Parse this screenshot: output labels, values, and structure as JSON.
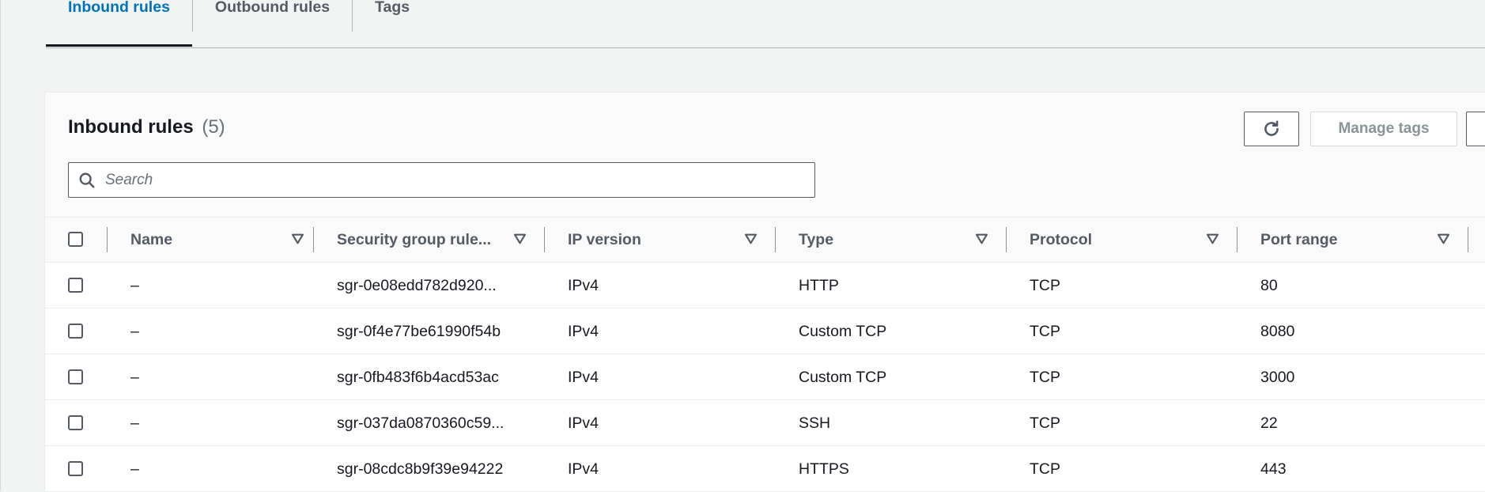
{
  "tabs": [
    {
      "label": "Inbound rules",
      "active": true
    },
    {
      "label": "Outbound rules",
      "active": false
    },
    {
      "label": "Tags",
      "active": false
    }
  ],
  "panel": {
    "title": "Inbound rules",
    "count": "(5)",
    "manage_tags_label": "Manage tags",
    "refresh_icon": "refresh-icon"
  },
  "search": {
    "placeholder": "Search",
    "value": ""
  },
  "table": {
    "columns": [
      "Name",
      "Security group rule...",
      "IP version",
      "Type",
      "Protocol",
      "Port range"
    ],
    "rows": [
      {
        "name": "–",
        "rule_id": "sgr-0e08edd782d920...",
        "ip_version": "IPv4",
        "type": "HTTP",
        "protocol": "TCP",
        "port_range": "80"
      },
      {
        "name": "–",
        "rule_id": "sgr-0f4e77be61990f54b",
        "ip_version": "IPv4",
        "type": "Custom TCP",
        "protocol": "TCP",
        "port_range": "8080"
      },
      {
        "name": "–",
        "rule_id": "sgr-0fb483f6b4acd53ac",
        "ip_version": "IPv4",
        "type": "Custom TCP",
        "protocol": "TCP",
        "port_range": "3000"
      },
      {
        "name": "–",
        "rule_id": "sgr-037da0870360c59...",
        "ip_version": "IPv4",
        "type": "SSH",
        "protocol": "TCP",
        "port_range": "22"
      },
      {
        "name": "–",
        "rule_id": "sgr-08cdc8b9f39e94222",
        "ip_version": "IPv4",
        "type": "HTTPS",
        "protocol": "TCP",
        "port_range": "443"
      }
    ]
  },
  "colors": {
    "accent": "#0073bb",
    "text": "#16191f",
    "muted": "#545b64"
  }
}
